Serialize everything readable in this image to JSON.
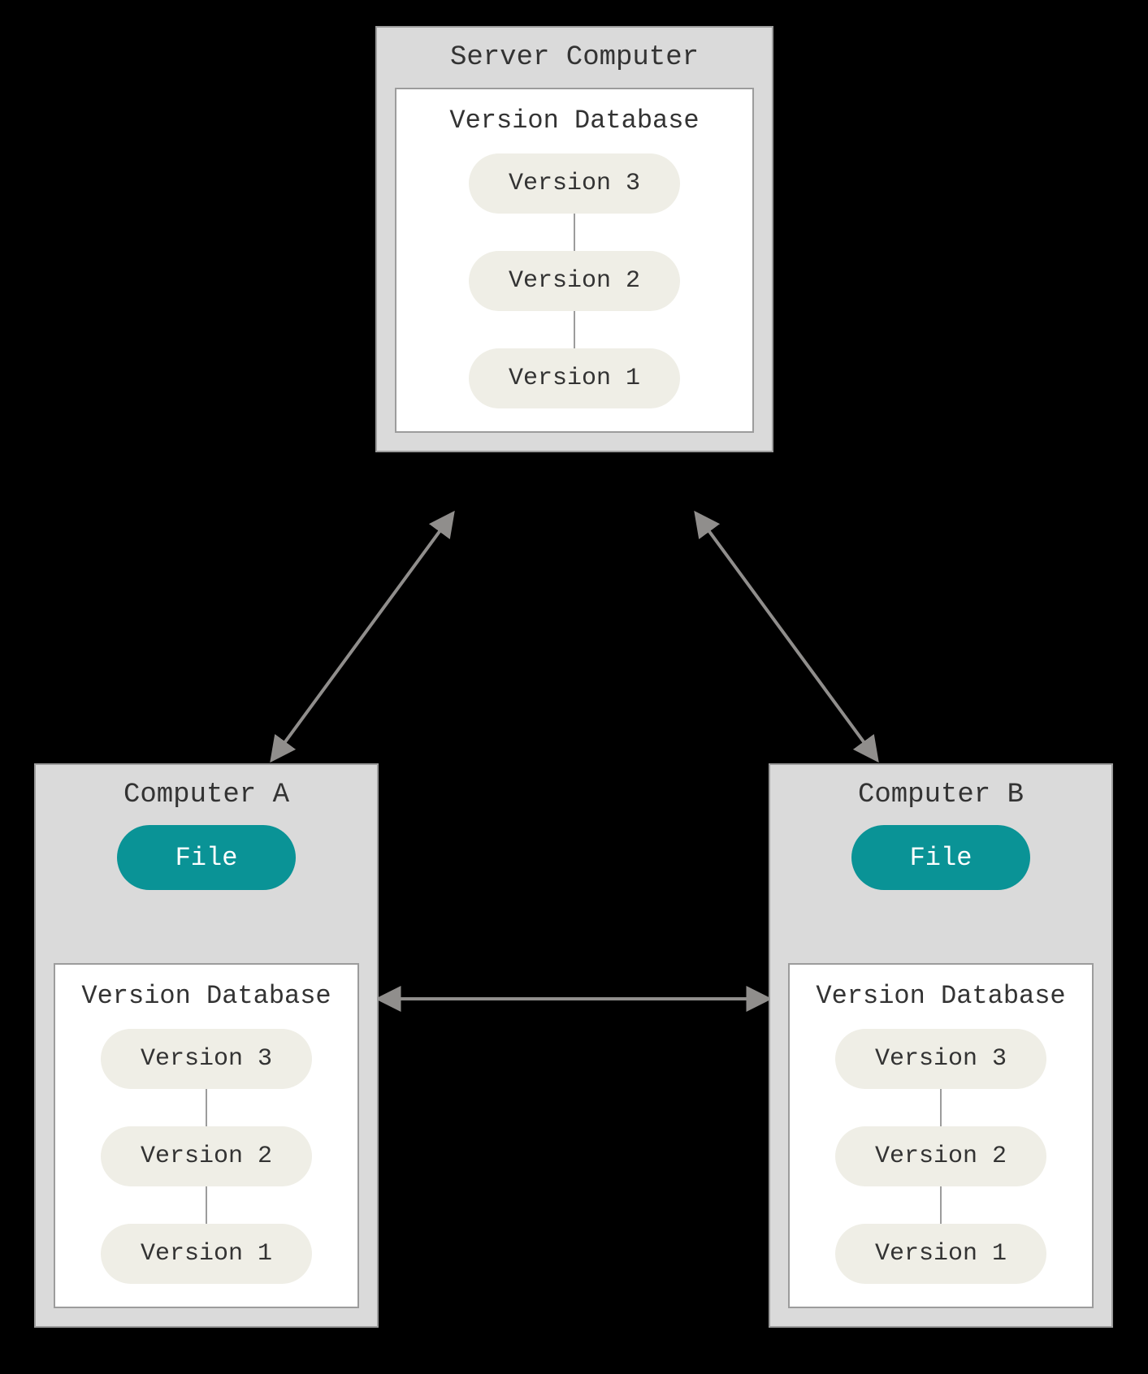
{
  "colors": {
    "background": "#000000",
    "box_fill": "#dadada",
    "box_border": "#9c9c9c",
    "db_fill": "#ffffff",
    "pill_fill": "#efeee6",
    "file_fill": "#0a9396",
    "arrow": "#908e8c",
    "text": "#333333",
    "file_text": "#ffffff"
  },
  "server": {
    "title": "Server Computer",
    "db_title": "Version Database",
    "versions": [
      "Version 3",
      "Version 2",
      "Version 1"
    ]
  },
  "clients": [
    {
      "id": "A",
      "title": "Computer A",
      "file_label": "File",
      "db_title": "Version Database",
      "versions": [
        "Version 3",
        "Version 2",
        "Version 1"
      ]
    },
    {
      "id": "B",
      "title": "Computer B",
      "file_label": "File",
      "db_title": "Version Database",
      "versions": [
        "Version 3",
        "Version 2",
        "Version 1"
      ]
    }
  ],
  "connections": [
    {
      "from": "server",
      "to": "clientA",
      "bidirectional": true
    },
    {
      "from": "server",
      "to": "clientB",
      "bidirectional": true
    },
    {
      "from": "clientA",
      "to": "clientB",
      "bidirectional": true
    },
    {
      "from": "clientA.db",
      "to": "clientA.file",
      "bidirectional": false
    },
    {
      "from": "clientB.db",
      "to": "clientB.file",
      "bidirectional": false
    }
  ]
}
